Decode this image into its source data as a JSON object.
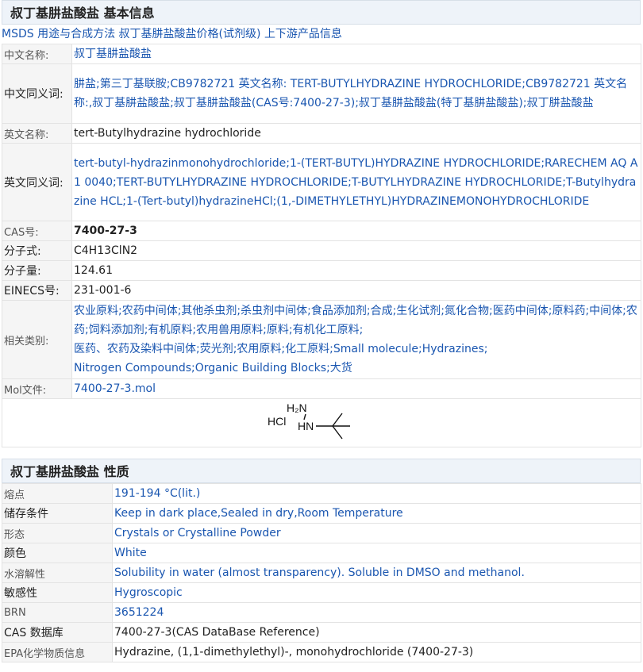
{
  "basic": {
    "header": "叔丁基肼盐酸盐 基本信息",
    "links": [
      "MSDS",
      "用途与合成方法",
      "叔丁基肼盐酸盐价格(试剂级)",
      "上下游产品信息"
    ],
    "rows": [
      {
        "label": "中文名称:",
        "value": "叔丁基肼盐酸盐",
        "blue": true
      },
      {
        "label": "中文同义词:",
        "value": "肼盐;第三丁基联胺;CB9782721 英文名称: TERT-BUTYLHYDRAZINE HYDROCHLORIDE;CB9782721 英文名称:,叔丁基肼盐酸盐;叔丁基肼盐酸盐(CAS号:7400-27-3);叔丁基肼盐酸盐(特丁基肼盐酸盐);叔丁肼盐酸盐",
        "blue": true,
        "darkLabel": true
      },
      {
        "label": "英文名称:",
        "value": "tert-Butylhydrazine hydrochloride"
      },
      {
        "label": "英文同义词:",
        "value": "tert-butyl-hydrazinmonohydrochloride;1-(TERT-BUTYL)HYDRAZINE HYDROCHLORIDE;RARECHEM AQ A1 0040;TERT-BUTYLHYDRAZINE HYDROCHLORIDE;T-BUTYLHYDRAZINE HYDROCHLORIDE;T-Butylhydrazine HCL;1-(Tert-butyl)hydrazineHCl;(1,-DIMETHYLETHYL)HYDRAZINEMONOHYDROCHLORIDE",
        "blue": true,
        "darkLabel": true
      },
      {
        "label": "CAS号:",
        "value": "7400-27-3",
        "bold": true
      },
      {
        "label": "分子式:",
        "value": "C4H13ClN2",
        "darkLabel": true
      },
      {
        "label": "分子量:",
        "value": "124.61",
        "darkLabel": true
      },
      {
        "label": "EINECS号:",
        "value": "231-001-6",
        "darkLabel": true
      },
      {
        "label": "相关类别:",
        "value": "农业原料;农药中间体;其他杀虫剂;杀虫剂中间体;食品添加剂;合成;生化试剂;氮化合物;医药中间体;原料药;中间体;农药;饲料添加剂;有机原料;农用兽用原料;原料;有机化工原料;\n医药、农药及染料中间体;荧光剂;农用原料;化工原料;Small molecule;Hydrazines;\nNitrogen Compounds;Organic Building Blocks;大货",
        "blue": true
      },
      {
        "label": "Mol文件:",
        "value": "7400-27-3.mol",
        "blue": true
      }
    ],
    "structure": {
      "hcl": "HCl",
      "h2n": "H₂N",
      "hn": "HN"
    }
  },
  "props": {
    "header": "叔丁基肼盐酸盐 性质",
    "rows": [
      {
        "label": "熔点",
        "value": "191-194 °C(lit.)"
      },
      {
        "label": "储存条件",
        "value": "Keep in dark place,Sealed in dry,Room Temperature",
        "darkLabel": true
      },
      {
        "label": "形态",
        "value": "Crystals or Crystalline Powder"
      },
      {
        "label": "颜色",
        "value": "White",
        "darkLabel": true
      },
      {
        "label": "水溶解性",
        "value": "Solubility in water (almost transparency). Soluble in DMSO and methanol."
      },
      {
        "label": "敏感性",
        "value": "Hygroscopic",
        "darkLabel": true
      },
      {
        "label": "BRN",
        "value": "3651224"
      },
      {
        "label": "CAS 数据库",
        "value": "7400-27-3(CAS DataBase Reference)",
        "darkLabel": true,
        "plain": true
      },
      {
        "label": "EPA化学物质信息",
        "value": "Hydrazine, (1,1-dimethylethyl)-, monohydrochloride (7400-27-3)",
        "plain": true
      }
    ]
  }
}
